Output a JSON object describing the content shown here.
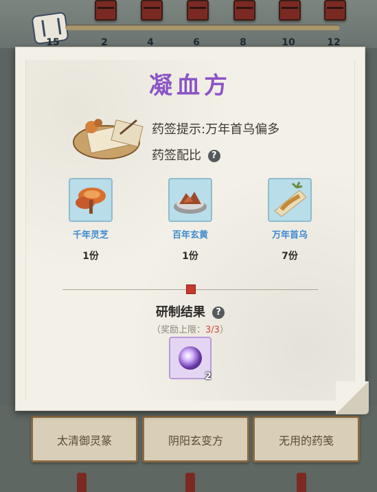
{
  "progress": {
    "ticks": [
      "15",
      "2",
      "4",
      "6",
      "8",
      "10",
      "12"
    ]
  },
  "panel": {
    "title": "凝血方",
    "hint": "药签提示:万年首乌偏多",
    "ratio_label": "药签配比",
    "help_icon": "?",
    "ingredients": [
      {
        "name": "千年灵芝",
        "qty": "1份",
        "icon": "lingzhi-icon"
      },
      {
        "name": "百年玄黄",
        "qty": "1份",
        "icon": "xuanhuang-icon"
      },
      {
        "name": "万年首乌",
        "qty": "7份",
        "icon": "shouwu-icon"
      }
    ],
    "result_title": "研制结果",
    "limit_prefix": "（奖励上限：",
    "limit_value": "3/3",
    "limit_suffix": "）",
    "reward_count": "2"
  },
  "background_buttons": [
    "太清御灵篆",
    "阴阳玄变方",
    "无用的药笺"
  ],
  "colors": {
    "title": "#8a54c6",
    "ingredient_name": "#3c8ad0",
    "limit_value": "#d0463b"
  }
}
